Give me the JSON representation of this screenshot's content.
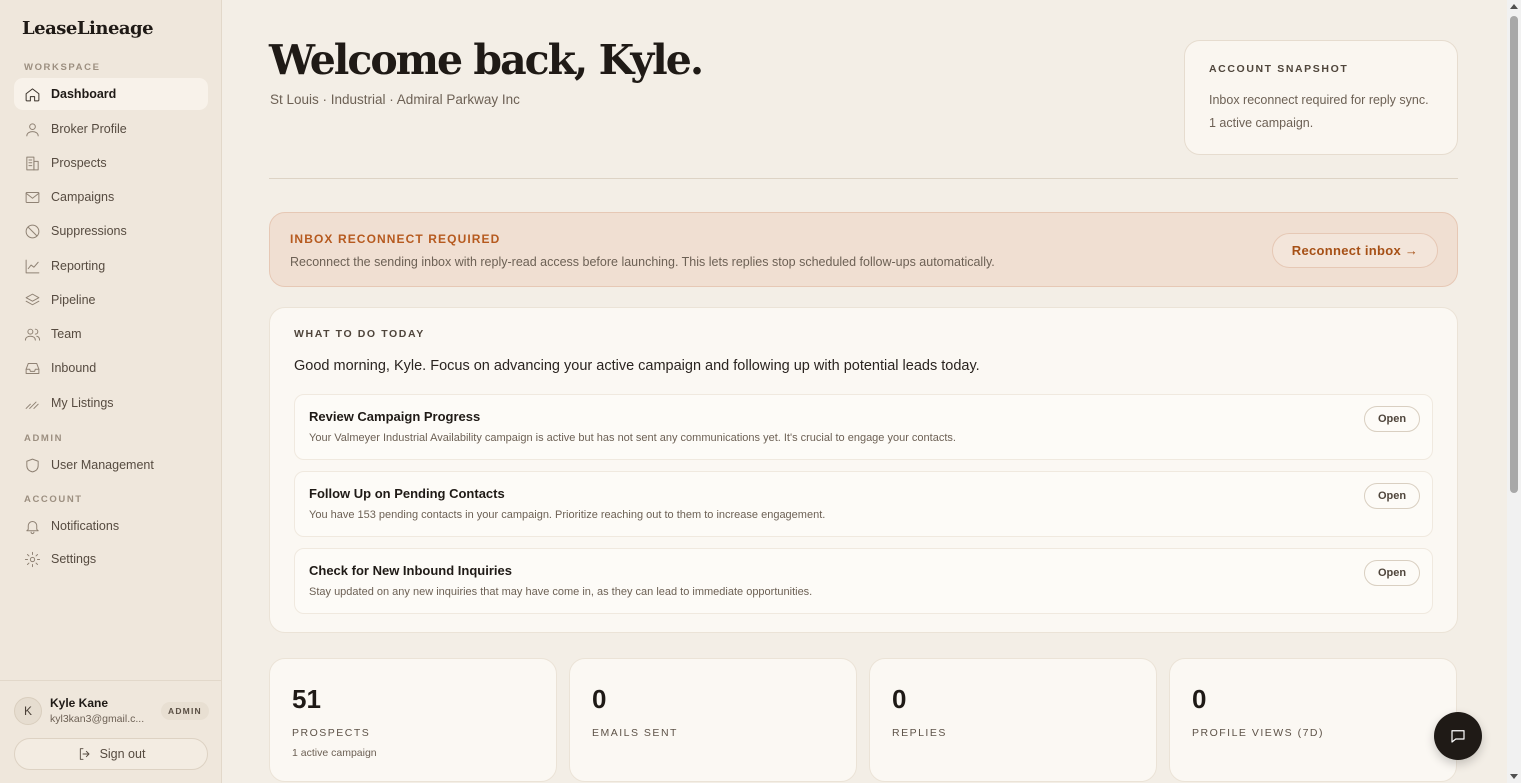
{
  "app": {
    "name": "LeaseLineage"
  },
  "sidebar": {
    "sections": {
      "workspace": "WORKSPACE",
      "admin": "ADMIN",
      "account": "ACCOUNT"
    },
    "workspace_items": [
      {
        "label": "Dashboard",
        "icon": "home-icon",
        "active": true
      },
      {
        "label": "Broker Profile",
        "icon": "user-icon"
      },
      {
        "label": "Prospects",
        "icon": "building-icon"
      },
      {
        "label": "Campaigns",
        "icon": "mail-icon"
      },
      {
        "label": "Suppressions",
        "icon": "ban-icon"
      },
      {
        "label": "Reporting",
        "icon": "chart-icon"
      },
      {
        "label": "Pipeline",
        "icon": "layers-icon"
      },
      {
        "label": "Team",
        "icon": "users-icon"
      },
      {
        "label": "Inbound",
        "icon": "inbox-icon"
      },
      {
        "label": "My Listings",
        "icon": "signature-icon"
      }
    ],
    "admin_items": [
      {
        "label": "User Management",
        "icon": "shield-icon"
      }
    ],
    "account_items": [
      {
        "label": "Notifications",
        "icon": "bell-icon"
      },
      {
        "label": "Settings",
        "icon": "gear-icon"
      }
    ],
    "user": {
      "initial": "K",
      "name": "Kyle Kane",
      "email": "kyl3kan3@gmail.c...",
      "role": "ADMIN"
    },
    "signout_label": "Sign out"
  },
  "header": {
    "welcome": "Welcome back, Kyle.",
    "subtitle": "St Louis · Industrial · Admiral Parkway Inc"
  },
  "snapshot": {
    "label": "ACCOUNT SNAPSHOT",
    "lines": [
      "Inbox reconnect required for reply sync.",
      "1 active campaign."
    ]
  },
  "alert": {
    "title": "INBOX RECONNECT REQUIRED",
    "text": "Reconnect the sending inbox with reply-read access before launching. This lets replies stop scheduled follow-ups automatically.",
    "button": "Reconnect inbox →"
  },
  "today": {
    "label": "WHAT TO DO TODAY",
    "intro": "Good morning, Kyle. Focus on advancing your active campaign and following up with potential leads today.",
    "tasks": [
      {
        "title": "Review Campaign Progress",
        "desc": "Your Valmeyer Industrial Availability campaign is active but has not sent any communications yet. It's crucial to engage your contacts.",
        "button": "Open"
      },
      {
        "title": "Follow Up on Pending Contacts",
        "desc": "You have 153 pending contacts in your campaign. Prioritize reaching out to them to increase engagement.",
        "button": "Open"
      },
      {
        "title": "Check for New Inbound Inquiries",
        "desc": "Stay updated on any new inquiries that may have come in, as they can lead to immediate opportunities.",
        "button": "Open"
      }
    ]
  },
  "stats": [
    {
      "value": "51",
      "label": "PROSPECTS",
      "note": "1 active campaign"
    },
    {
      "value": "0",
      "label": "EMAILS SENT",
      "note": ""
    },
    {
      "value": "0",
      "label": "REPLIES",
      "note": ""
    },
    {
      "value": "0",
      "label": "PROFILE VIEWS (7D)",
      "note": ""
    }
  ],
  "colors": {
    "accent": "#b65a1f",
    "sidebar_bg": "#efe7dc",
    "page_bg": "#f3eee6",
    "alert_bg": "#f0dfd2"
  }
}
